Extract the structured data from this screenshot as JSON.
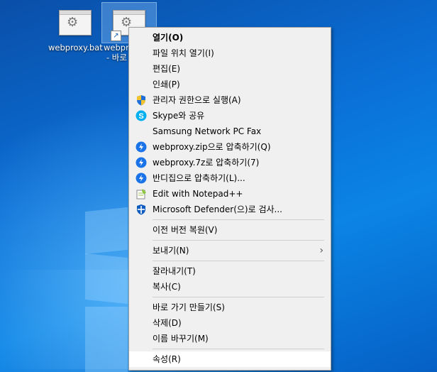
{
  "desktop": {
    "icons": [
      {
        "label": "webproxy.bat",
        "icon": "batch-file-icon"
      },
      {
        "label": "webpr",
        "label2": "- 바로",
        "icon": "batch-file-shortcut-icon"
      }
    ]
  },
  "context_menu": {
    "items": [
      {
        "label": "열기(O)",
        "icon": "",
        "bold": true
      },
      {
        "label": "파일 위치 열기(I)",
        "icon": ""
      },
      {
        "label": "편집(E)",
        "icon": ""
      },
      {
        "label": "인쇄(P)",
        "icon": ""
      },
      {
        "label": "관리자 권한으로 실행(A)",
        "icon": "uac-shield-icon"
      },
      {
        "label": "Skype와 공유",
        "icon": "skype-icon"
      },
      {
        "label": "Samsung Network PC Fax",
        "icon": ""
      },
      {
        "label": "webproxy.zip으로 압축하기(Q)",
        "icon": "bandizip-icon"
      },
      {
        "label": "webproxy.7z로 압축하기(7)",
        "icon": "bandizip-icon"
      },
      {
        "label": "반디집으로 압축하기(L)...",
        "icon": "bandizip-icon"
      },
      {
        "label": "Edit with Notepad++",
        "icon": "notepadpp-icon"
      },
      {
        "label": "Microsoft Defender(으)로 검사...",
        "icon": "defender-icon"
      },
      {
        "label": "이전 버전 복원(V)",
        "icon": ""
      },
      {
        "label": "보내기(N)",
        "icon": "",
        "submenu": "chevron-right-icon"
      },
      {
        "label": "잘라내기(T)",
        "icon": ""
      },
      {
        "label": "복사(C)",
        "icon": ""
      },
      {
        "label": "바로 가기 만들기(S)",
        "icon": ""
      },
      {
        "label": "삭제(D)",
        "icon": ""
      },
      {
        "label": "이름 바꾸기(M)",
        "icon": ""
      },
      {
        "label": "속성(R)",
        "icon": "",
        "highlighted": true
      }
    ]
  },
  "colors": {
    "accent": "#0078d7",
    "menu_bg": "#f0f0f0",
    "highlight": "#ffffff"
  }
}
